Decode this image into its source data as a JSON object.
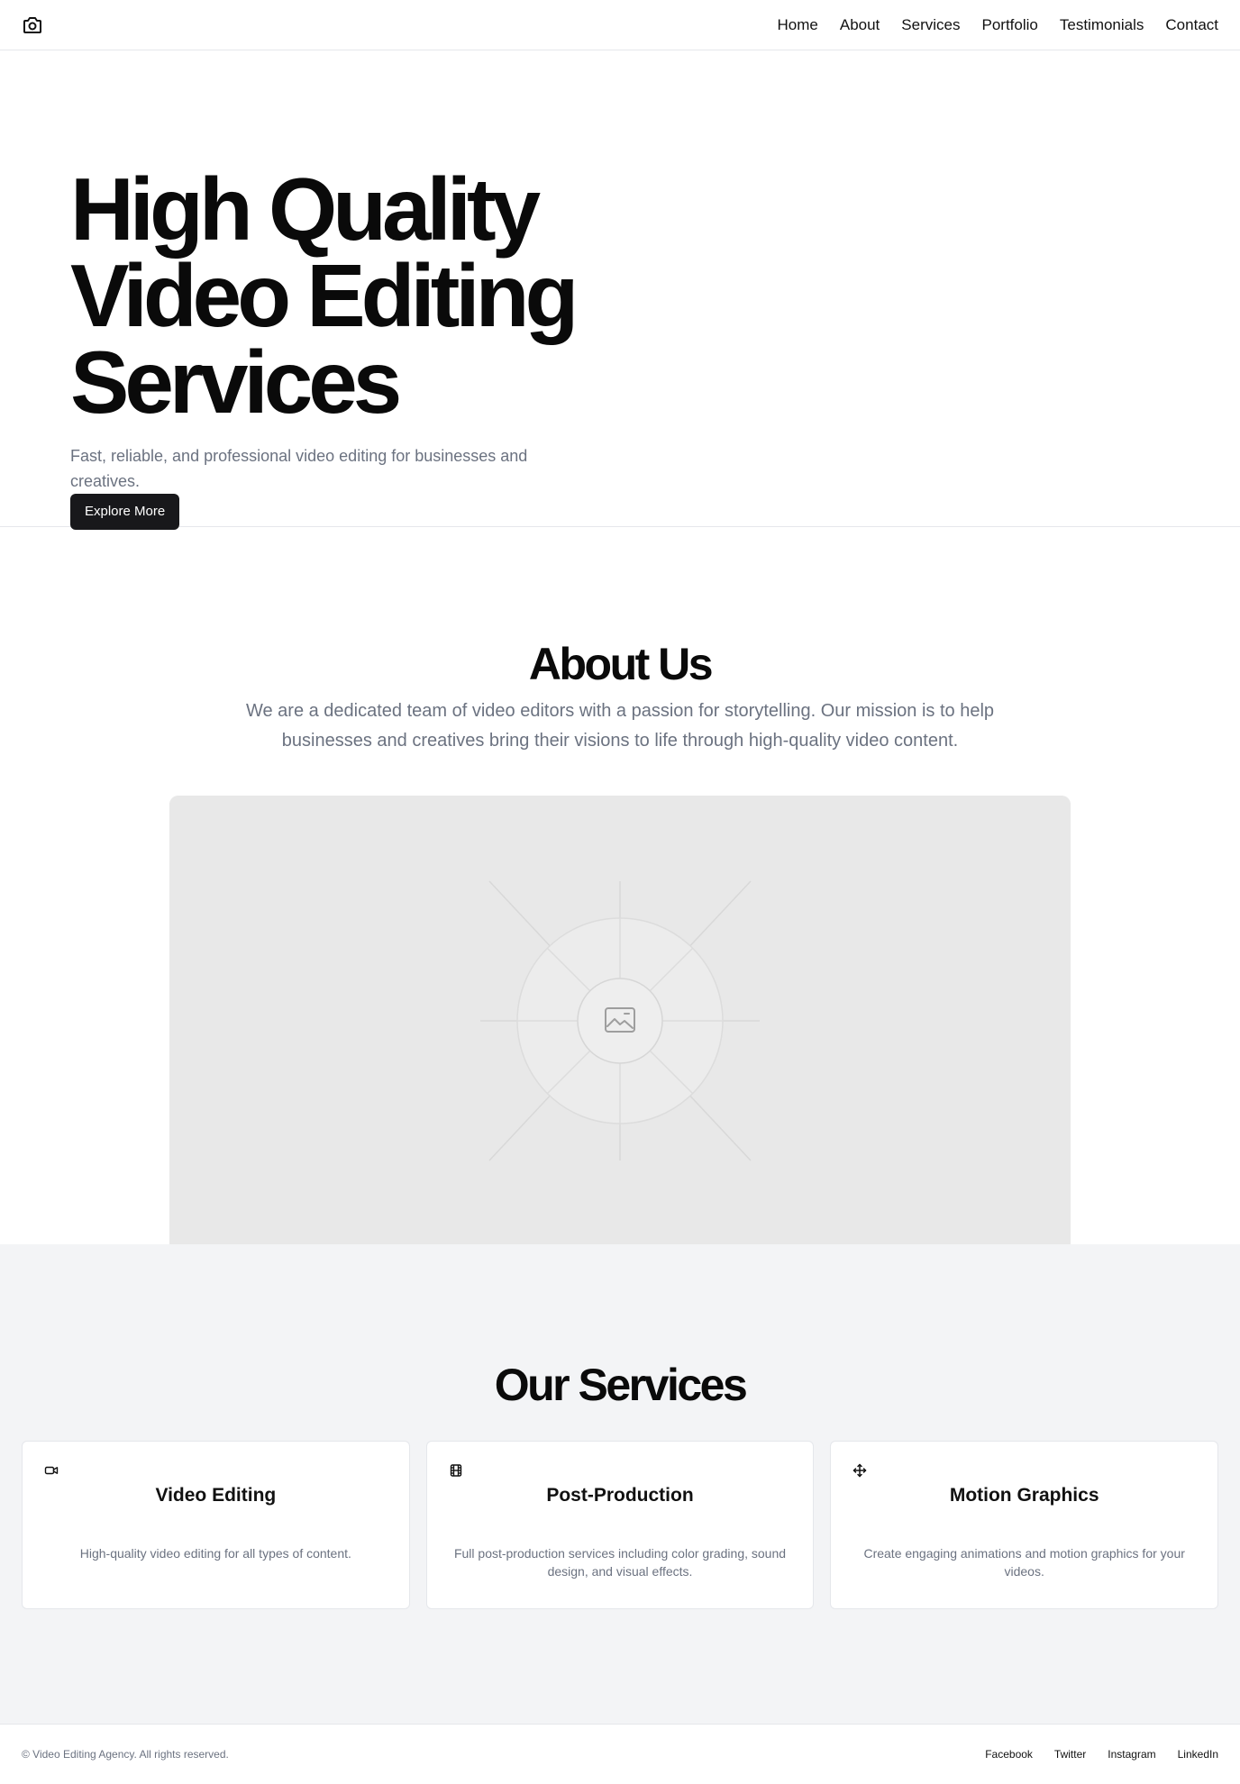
{
  "header": {
    "logo_icon": "camera-icon",
    "nav": [
      {
        "label": "Home"
      },
      {
        "label": "About"
      },
      {
        "label": "Services"
      },
      {
        "label": "Portfolio"
      },
      {
        "label": "Testimonials"
      },
      {
        "label": "Contact"
      }
    ]
  },
  "hero": {
    "title": "High Quality Video Editing Services",
    "subtitle": "Fast, reliable, and professional video editing for businesses and creatives.",
    "cta_label": "Explore More"
  },
  "about": {
    "title": "About Us",
    "text": "We are a dedicated team of video editors with a passion for storytelling. Our mission is to help businesses and creatives bring their visions to life through high-quality video content.",
    "image_icon": "image-placeholder-icon"
  },
  "services": {
    "title": "Our Services",
    "items": [
      {
        "icon": "video-camera-icon",
        "title": "Video Editing",
        "text": "High-quality video editing for all types of content."
      },
      {
        "icon": "film-icon",
        "title": "Post-Production",
        "text": "Full post-production services including color grading, sound design, and visual effects."
      },
      {
        "icon": "move-icon",
        "title": "Motion Graphics",
        "text": "Create engaging animations and motion graphics for your videos."
      }
    ]
  },
  "footer": {
    "copyright": "© Video Editing Agency. All rights reserved.",
    "links": [
      {
        "label": "Facebook"
      },
      {
        "label": "Twitter"
      },
      {
        "label": "Instagram"
      },
      {
        "label": "LinkedIn"
      }
    ]
  },
  "colors": {
    "text": "#0a0a0a",
    "muted": "#6b7280",
    "button_bg": "#18181b",
    "section_bg": "#f3f4f6",
    "placeholder_bg": "#e8e8e8"
  }
}
